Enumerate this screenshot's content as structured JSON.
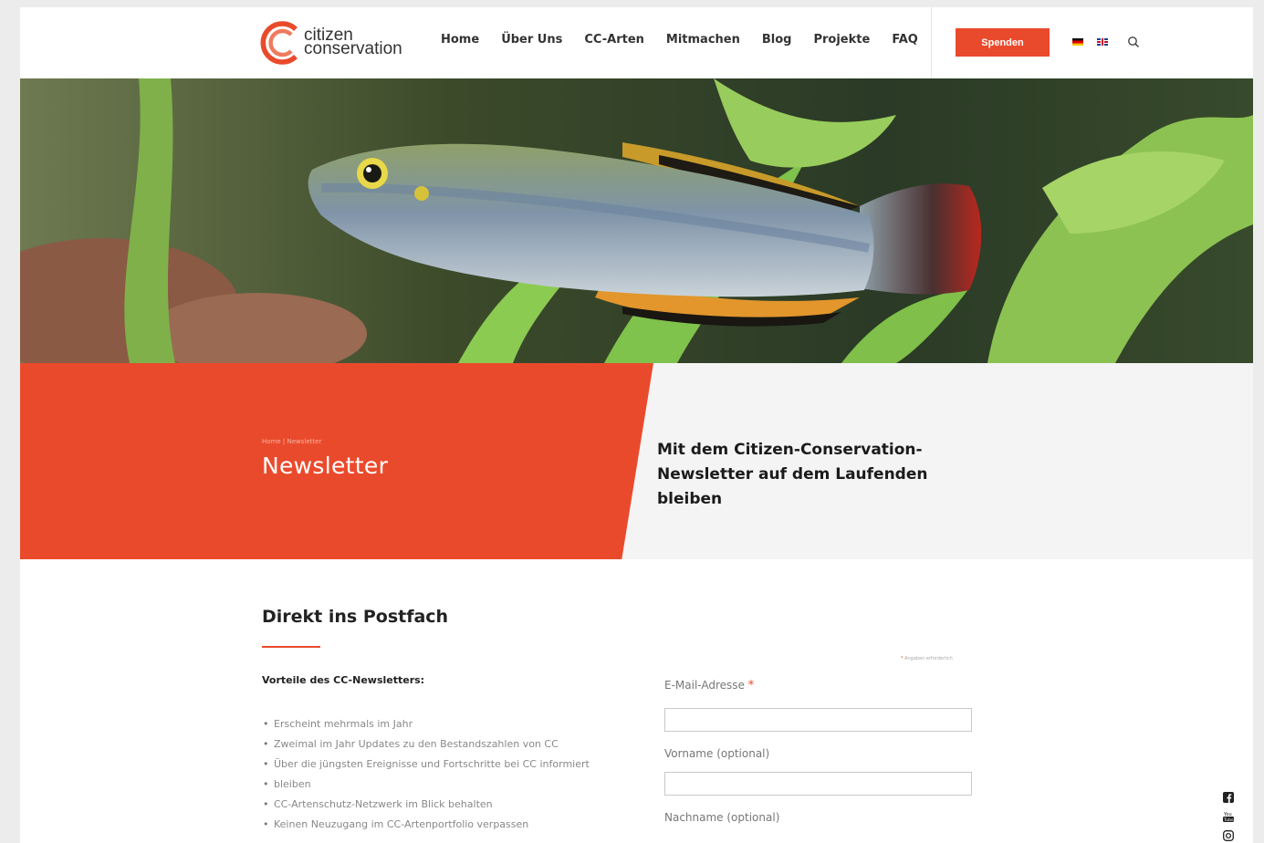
{
  "header": {
    "logo": {
      "line1": "citizen",
      "line2": "conservation"
    },
    "nav": [
      "Home",
      "Über Uns",
      "CC-Arten",
      "Mitmachen",
      "Blog",
      "Projekte",
      "FAQ"
    ],
    "donate_label": "Spenden",
    "languages": [
      "de",
      "en"
    ]
  },
  "hero": {
    "image": "photo of a blue rainbowfish with orange-striped fins among green aquatic plants"
  },
  "title_band": {
    "breadcrumb": "Home | Newsletter",
    "title": "Newsletter",
    "tagline": "Mit dem Citizen-Conservation-Newsletter auf dem Laufenden bleiben"
  },
  "content": {
    "section_title": "Direkt ins Postfach",
    "benefits_heading": "Vorteile des CC-Newsletters:",
    "benefits": [
      "Erscheint mehrmals im Jahr",
      "Zweimal im Jahr Updates zu den Bestandszahlen von CC",
      "Über die jüngsten Ereignisse und Fortschritte bei CC informiert",
      "bleiben",
      "CC-Artenschutz-Netzwerk im Blick behalten",
      "Keinen Neuzugang im CC-Artenportfolio verpassen"
    ]
  },
  "form": {
    "required_note": "Angaben erforderlich",
    "email_label": "E-Mail-Adresse",
    "email_value": "",
    "first_name_label": "Vorname (optional)",
    "first_name_value": "",
    "last_name_label": "Nachname (optional)"
  },
  "social": [
    "facebook-icon",
    "youtube-icon",
    "instagram-icon"
  ],
  "colors": {
    "accent": "#ea4a2c",
    "band_light": "#f4f4f4"
  }
}
